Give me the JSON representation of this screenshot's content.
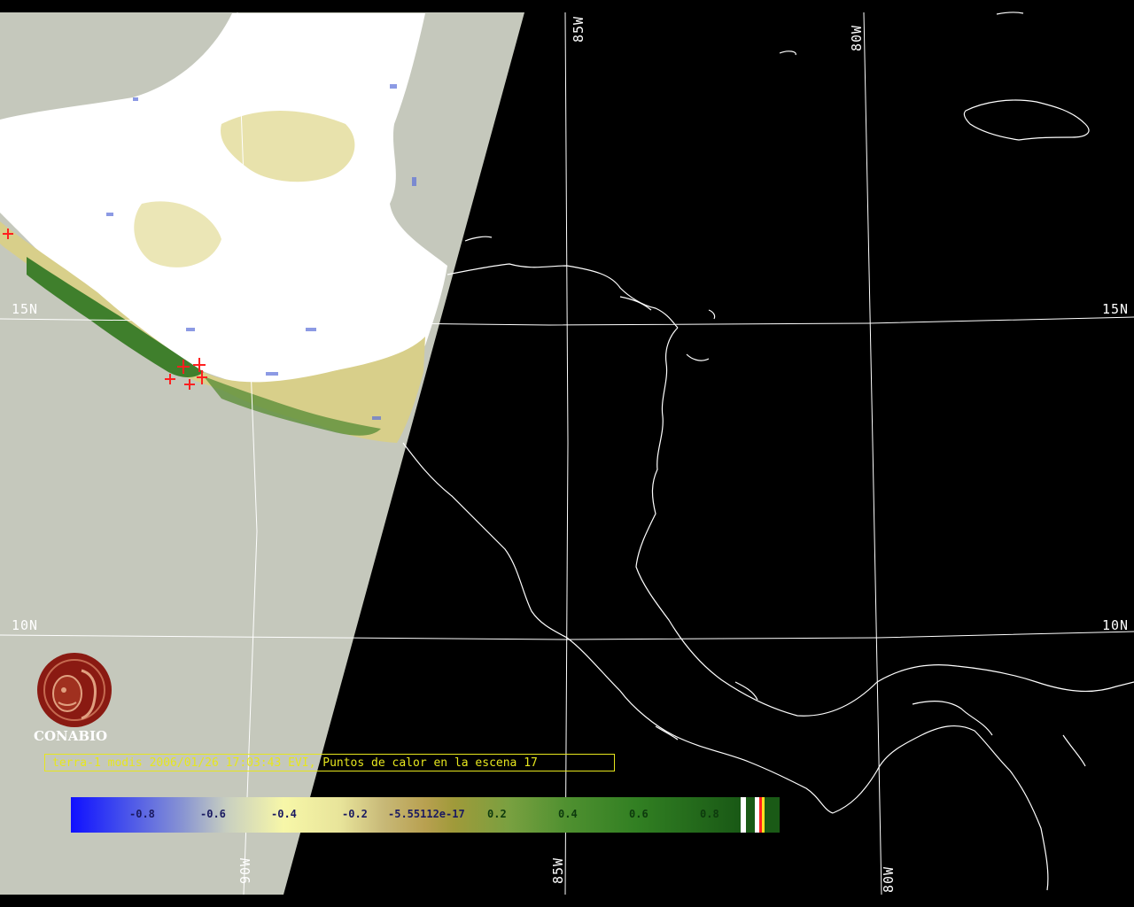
{
  "grid_labels": {
    "lat_15_left": "15N",
    "lat_15_right": "15N",
    "lat_10_left": "10N",
    "lat_10_right": "10N",
    "lon_85_top": "85W",
    "lon_80_top": "80W",
    "lon_90_bottom": "90W",
    "lon_85_bottom": "85W",
    "lon_80_bottom": "80W"
  },
  "logo": {
    "name": "CONABIO"
  },
  "caption": "terra-1 modis 2006/01/26 17:03:43 EVI, Puntos de calor en la escena 17",
  "colorbar": {
    "ticks": [
      "-0.8",
      "-0.6",
      "-0.4",
      "-0.2",
      "-5.55112e-17",
      "0.2",
      "0.4",
      "0.6",
      "0.8"
    ]
  },
  "colors": {
    "coastline": "#ffffff",
    "grid": "#ffffff",
    "no_data": "#c5c8bc",
    "caption": "#e6e61e",
    "hotspot": "#ff2020"
  }
}
